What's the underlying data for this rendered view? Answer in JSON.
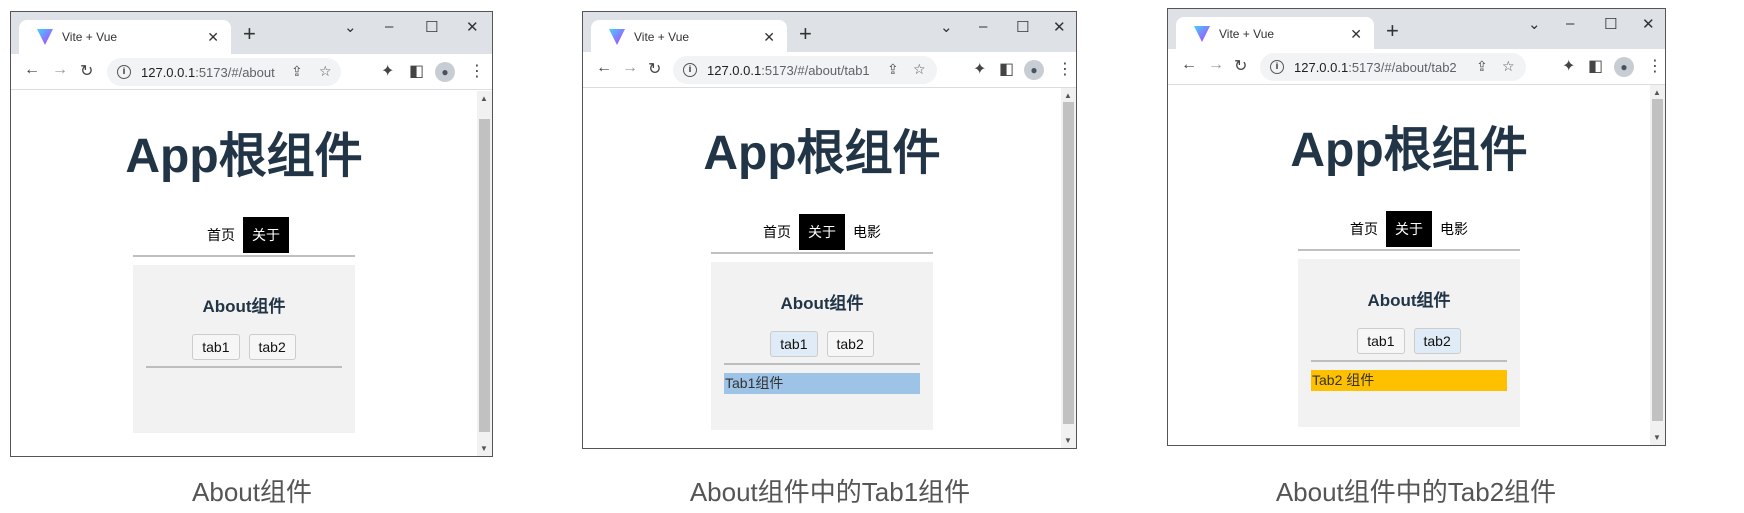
{
  "browser": {
    "tab_title": "Vite + Vue",
    "host": "127.0.0.1",
    "port_path_prefix": ":5173/#/"
  },
  "app": {
    "title": "App根组件",
    "nav": {
      "home": "首页",
      "about": "关于",
      "movie": "电影"
    },
    "about_title": "About组件",
    "tab1": "tab1",
    "tab2": "tab2"
  },
  "windows": [
    {
      "url_host": "127.0.0.1",
      "url_rest": ":5173/#/about",
      "caption": "About组件"
    },
    {
      "url_host": "127.0.0.1",
      "url_rest": ":5173/#/about/tab1",
      "caption": "About组件中的Tab1组件",
      "tab_content": "Tab1组件"
    },
    {
      "url_host": "127.0.0.1",
      "url_rest": ":5173/#/about/tab2",
      "caption": "About组件中的Tab2组件",
      "tab_content": "Tab2 组件"
    }
  ],
  "colors": {
    "title": "#213547",
    "tab1_bg": "#9dc3e6",
    "tab2_bg": "#ffc000",
    "active_nav": "#000000"
  }
}
